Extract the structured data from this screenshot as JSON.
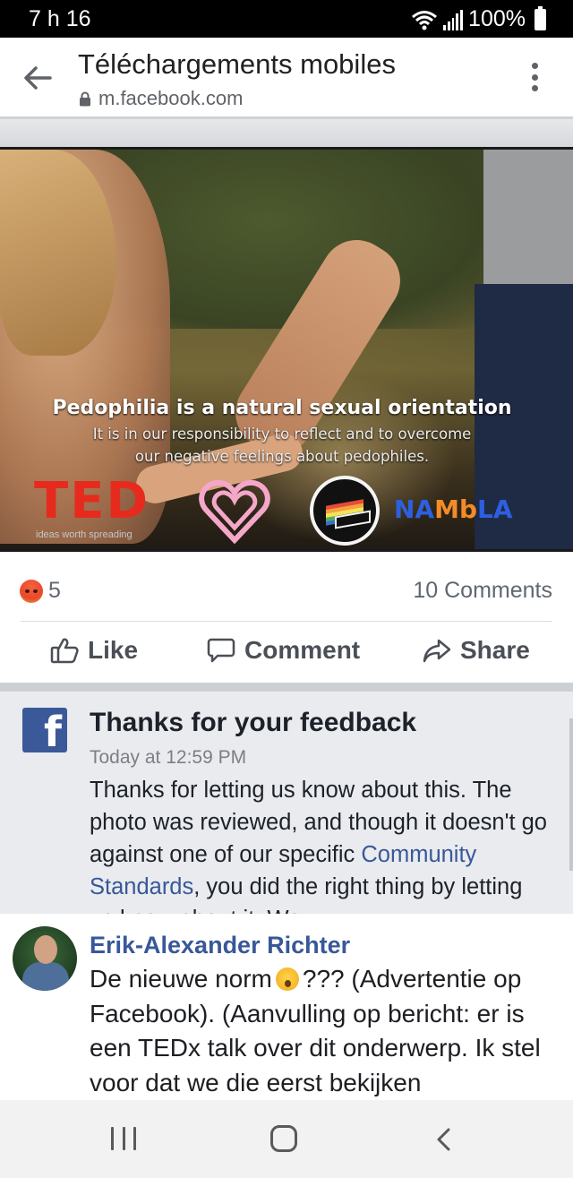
{
  "status_bar": {
    "time": "7 h 16",
    "battery": "100%"
  },
  "browser": {
    "title": "Téléchargements mobiles",
    "url": "m.facebook.com"
  },
  "post": {
    "poster_headline": "Pedophilia is a natural sexual orientation",
    "poster_line1": "It is in our responsibility to reflect and to overcome",
    "poster_line2": "our negative feelings about pedophiles.",
    "ted_logo": "TED",
    "ted_tagline": "ideas worth spreading",
    "nambla_logo": "NAMbLA",
    "colors": {
      "ted_red": "#e62b1e",
      "heart_pink": "#f4a7c9",
      "nambla_blue": "#2d5fe0",
      "nambla_orange": "#f28c28"
    },
    "reaction_icon": "angry-reaction-icon",
    "reaction_count": "5",
    "comments_count": "10 Comments",
    "actions": {
      "like": "Like",
      "comment": "Comment",
      "share": "Share"
    }
  },
  "feedback": {
    "title": "Thanks for your feedback",
    "time": "Today at 12:59 PM",
    "body_part1": "Thanks for letting us know about this. The photo was reviewed, and though it doesn't go against one of our specific ",
    "link": "Community Standards",
    "body_part2": ", you did the right thing by letting us know about it. We",
    "brand_color": "#3b5998"
  },
  "comment": {
    "author": "Erik-Alexander Richter",
    "text_part1": "De nieuwe norm",
    "emoji": "astonished-face-emoji",
    "text_part2": "??? (Advertentie op Facebook). (Aanvulling op bericht: er is een TEDx talk over dit onderwerp. Ik stel voor dat we die eerst bekijken",
    "author_color": "#385898"
  },
  "nav_bar": {
    "icons": [
      "recent-apps-icon",
      "home-icon",
      "back-icon"
    ]
  }
}
